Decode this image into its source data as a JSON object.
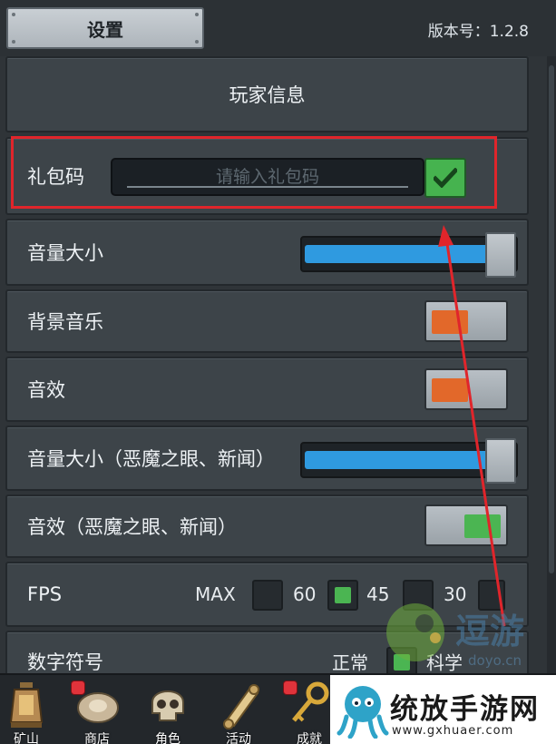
{
  "header": {
    "title": "设置",
    "version": "版本号：1.2.8"
  },
  "player_info": {
    "label": "玩家信息"
  },
  "gift_code": {
    "label": "礼包码",
    "placeholder": "请输入礼包码",
    "value": ""
  },
  "volume": {
    "label": "音量大小",
    "level": 1.0
  },
  "bgm": {
    "label": "背景音乐",
    "on": false
  },
  "sfx": {
    "label": "音效",
    "on": false
  },
  "volume_devil": {
    "label": "音量大小（恶魔之眼、新闻）",
    "level": 1.0
  },
  "sfx_devil": {
    "label": "音效（恶魔之眼、新闻）",
    "on": true
  },
  "fps": {
    "label": "FPS",
    "options": [
      {
        "label": "MAX",
        "selected": false
      },
      {
        "label": "60",
        "selected": true
      },
      {
        "label": "45",
        "selected": false
      },
      {
        "label": "30",
        "selected": false
      }
    ]
  },
  "number_format": {
    "label": "数字符号",
    "options": [
      {
        "label": "正常",
        "selected": true
      },
      {
        "label": "科学",
        "selected": false
      }
    ]
  },
  "nav": {
    "items": [
      {
        "label": "矿山",
        "icon": "lantern-icon",
        "badge": false
      },
      {
        "label": "商店",
        "icon": "ore-rock-icon",
        "badge": true
      },
      {
        "label": "角色",
        "icon": "skull-icon",
        "badge": false
      },
      {
        "label": "活动",
        "icon": "scroll-icon",
        "badge": false
      },
      {
        "label": "成就",
        "icon": "key-icon",
        "badge": true
      }
    ]
  },
  "watermarks": {
    "logo_text": "逗游",
    "logo_url": "doyo.cn",
    "banner_text": "统放手游网",
    "banner_url": "www.gxhuaer.com"
  },
  "colors": {
    "accent_blue": "#2f9ae0",
    "toggle_off": "#e2682a",
    "toggle_on": "#4bb552",
    "highlight_red": "#e0252b"
  }
}
